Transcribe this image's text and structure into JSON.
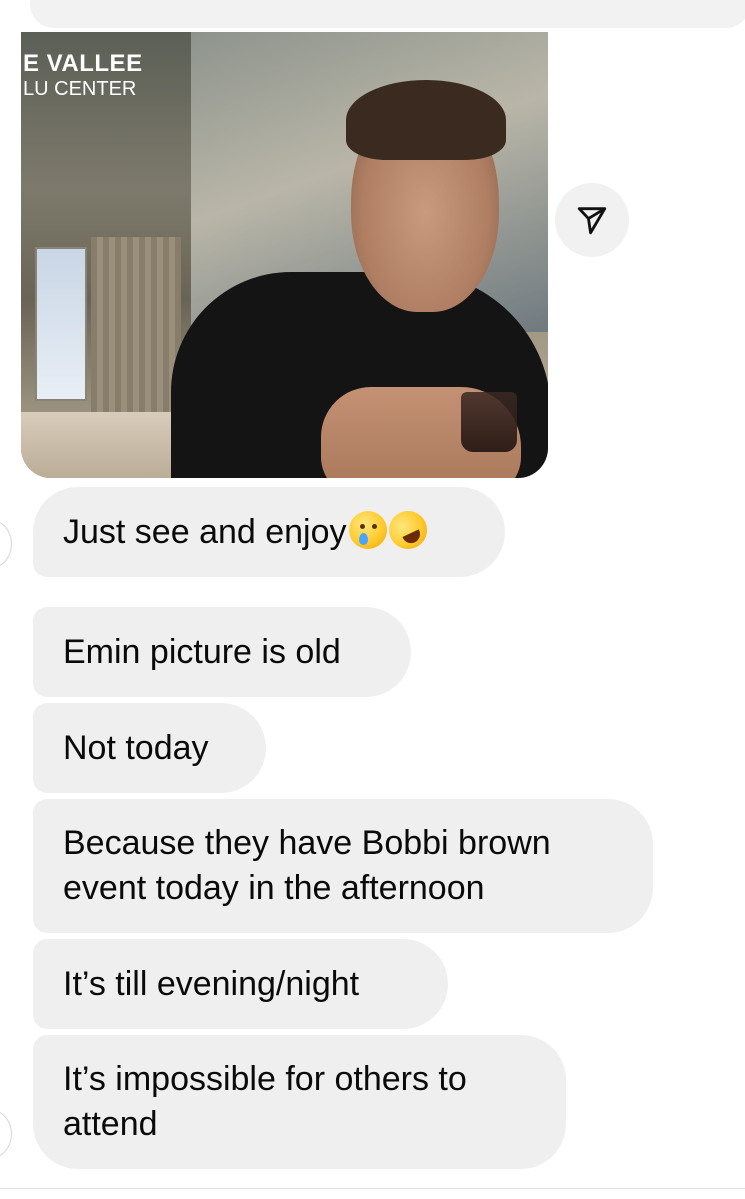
{
  "photo_message": {
    "sign_line_1": "E VALLEE",
    "sign_line_2": "LU CENTER",
    "alt": "photo"
  },
  "share_button": {
    "icon": "paper-plane-icon"
  },
  "messages": [
    {
      "text": "Just see and enjoy",
      "emojis": [
        "face-holding-back-tears",
        "rolling-on-floor-laughing"
      ]
    },
    {
      "text": "Emin picture is old"
    },
    {
      "text": "Not today"
    },
    {
      "text": "Because they have Bobbi brown event today in the afternoon"
    },
    {
      "text": "It’s till evening/night"
    },
    {
      "text": "It’s impossible for others to attend"
    }
  ],
  "colors": {
    "bubble_bg": "#efefef",
    "text": "#0a0a0a",
    "page_bg": "#ffffff"
  }
}
